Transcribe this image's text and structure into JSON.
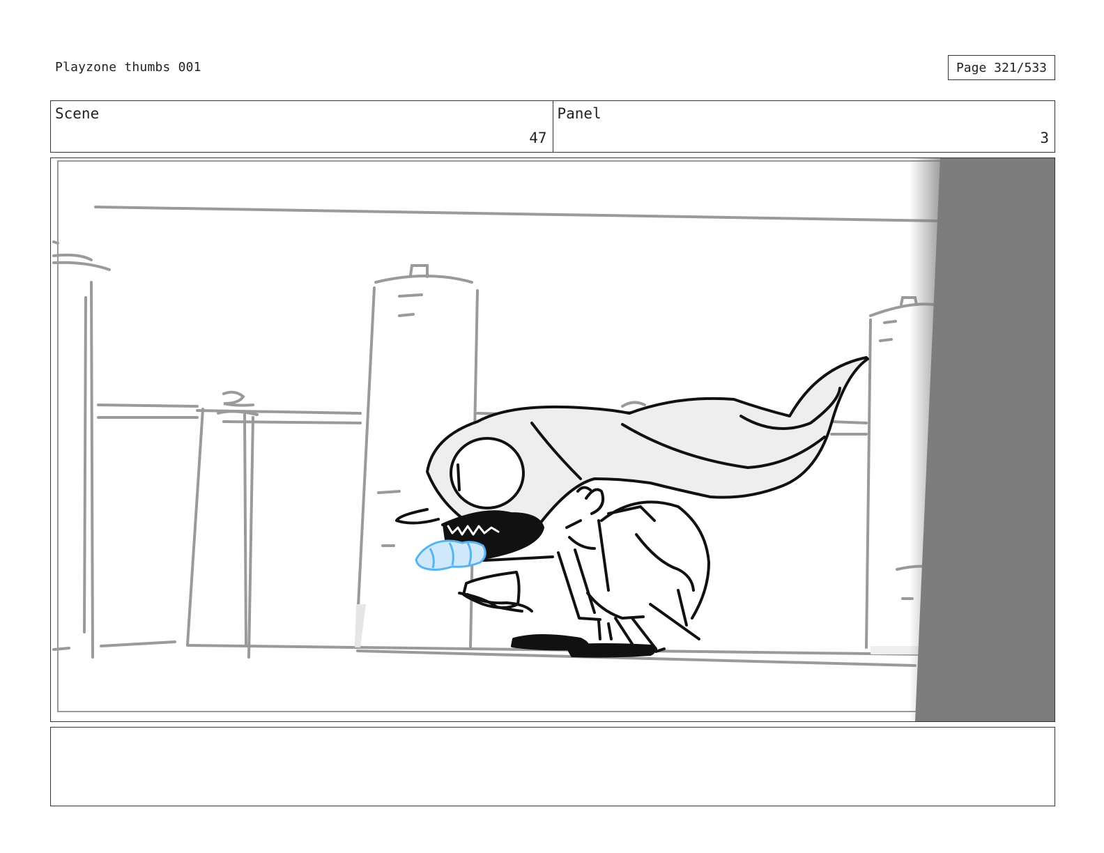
{
  "header": {
    "title": "Playzone thumbs 001",
    "page_indicator": "Page 321/533"
  },
  "info": {
    "scene_label": "Scene",
    "scene_value": "47",
    "panel_label": "Panel",
    "panel_value": "3"
  },
  "artwork": {
    "description_icon": "storyboard-sketch",
    "accent_colors": {
      "line": "#111111",
      "background_lines": "#9a9a9a",
      "fill": "#eeeeee",
      "highlight": "#56b4f0",
      "wall": "#7d7d7d"
    }
  },
  "notes": {
    "text": ""
  }
}
